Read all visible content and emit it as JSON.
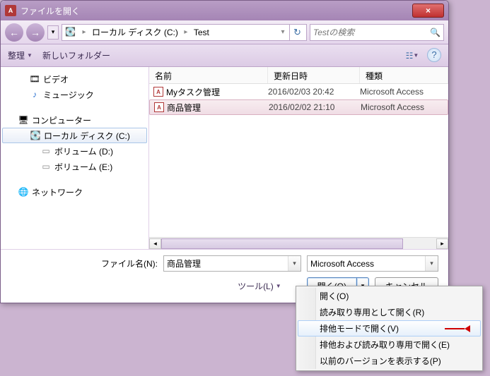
{
  "title": "ファイルを開く",
  "app_icon_letter": "A",
  "close_glyph": "×",
  "nav": {
    "back": "←",
    "fwd": "→",
    "dropdown": "▾"
  },
  "breadcrumb": {
    "segments": [
      "ローカル ディスク (C:)",
      "Test"
    ],
    "sep": "▸",
    "history_drop": "▾",
    "refresh": "↻"
  },
  "search": {
    "placeholder": "Testの検索",
    "icon": "🔍"
  },
  "toolbar": {
    "organize": "整理",
    "newfolder": "新しいフォルダー",
    "drop": "▼",
    "view_icon": "☷",
    "help_icon": "?"
  },
  "tree": {
    "videos": "ビデオ",
    "music": "ミュージック",
    "computer": "コンピューター",
    "localc": "ローカル ディスク (C:)",
    "vold": "ボリューム (D:)",
    "vole": "ボリューム (E:)",
    "network": "ネットワーク",
    "icons": {
      "video": "🎞",
      "music": "♪",
      "computer": "🖥",
      "disk_c": "💽",
      "disk": "▭",
      "network": "🌐"
    }
  },
  "columns": {
    "name": "名前",
    "date": "更新日時",
    "type": "種類"
  },
  "files": [
    {
      "name": "Myタスク管理",
      "date": "2016/02/03 20:42",
      "type": "Microsoft Access"
    },
    {
      "name": "商品管理",
      "date": "2016/02/02 21:10",
      "type": "Microsoft Access"
    }
  ],
  "file_icon_letter": "A",
  "filename_label": "ファイル名(N):",
  "filename_value": "商品管理",
  "filter_value": "Microsoft Access",
  "tools_label": "ツール(L)",
  "buttons": {
    "open": "開く(O)",
    "cancel": "キャンセル",
    "drop": "▾"
  },
  "menu": [
    "開く(O)",
    "読み取り専用として開く(R)",
    "排他モードで開く(V)",
    "排他および読み取り専用で開く(E)",
    "以前のバージョンを表示する(P)"
  ],
  "menu_highlight_index": 2,
  "scroll": {
    "left": "◂",
    "right": "▸"
  }
}
